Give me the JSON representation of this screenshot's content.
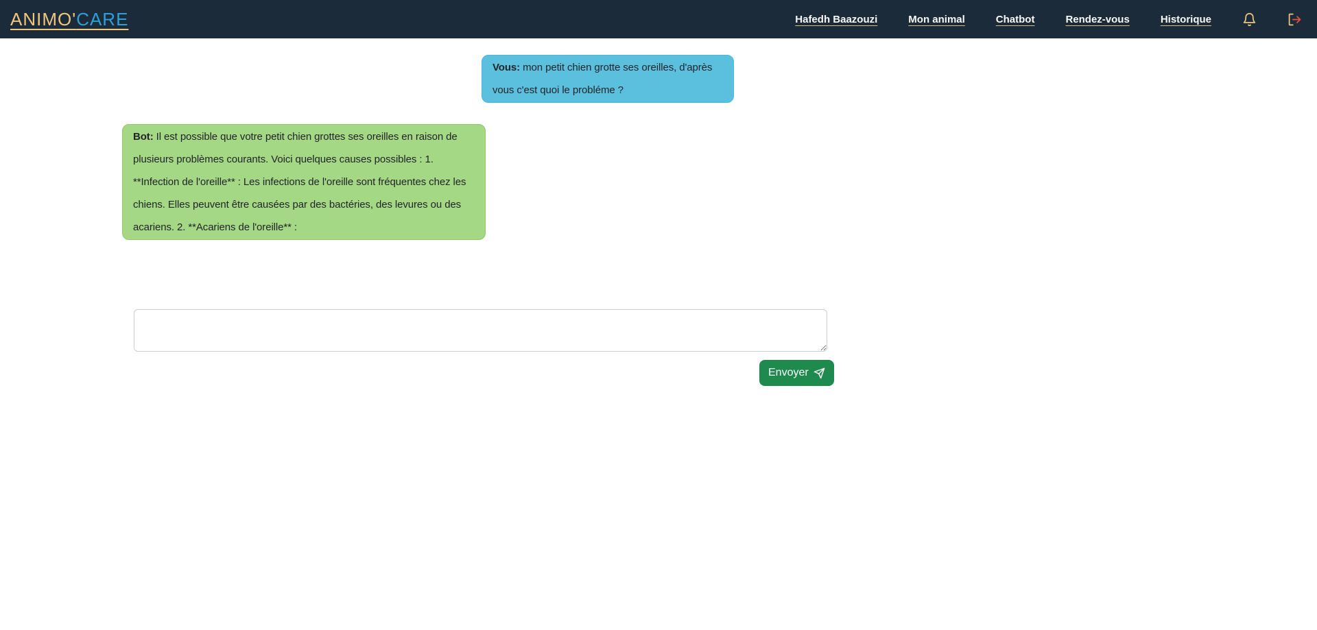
{
  "navbar": {
    "brand": {
      "part1": "ANIMO'",
      "part2": "CARE"
    },
    "links": [
      {
        "label": "Hafedh Baazouzi"
      },
      {
        "label": "Mon animal"
      },
      {
        "label": "Chatbot"
      },
      {
        "label": "Rendez-vous"
      },
      {
        "label": "Historique"
      }
    ],
    "icons": [
      {
        "name": "bell-icon"
      },
      {
        "name": "logout-icon"
      }
    ]
  },
  "chat": {
    "messages": [
      {
        "role": "user",
        "sender_label": "Vous:",
        "text": "mon petit chien grotte ses oreilles, d'après vous c'est quoi le probléme ?"
      },
      {
        "role": "bot",
        "sender_label": "Bot:",
        "text": "Il est possible que votre petit chien grottes ses oreilles en raison de plusieurs problèmes courants. Voici quelques causes possibles : 1. **Infection de l'oreille** : Les infections de l'oreille sont fréquentes chez les chiens. Elles peuvent être causées par des bactéries, des levures ou des acariens. 2. **Acariens de l'oreille** :"
      }
    ]
  },
  "composer": {
    "input_value": "",
    "send_label": "Envoyer"
  },
  "colors": {
    "navbar_bg": "#1c2b3a",
    "brand_gold": "#eec77d",
    "brand_blue": "#2d9fd9",
    "nav_link_text": "#f8f9fa",
    "user_bubble_bg": "#5bc0de",
    "user_bubble_border": "#46b8da",
    "bot_bubble_bg": "#a4d885",
    "bot_bubble_border": "#8bc96a",
    "send_button_bg": "#1e8a4d",
    "logout_arrow": "#e2553a"
  }
}
